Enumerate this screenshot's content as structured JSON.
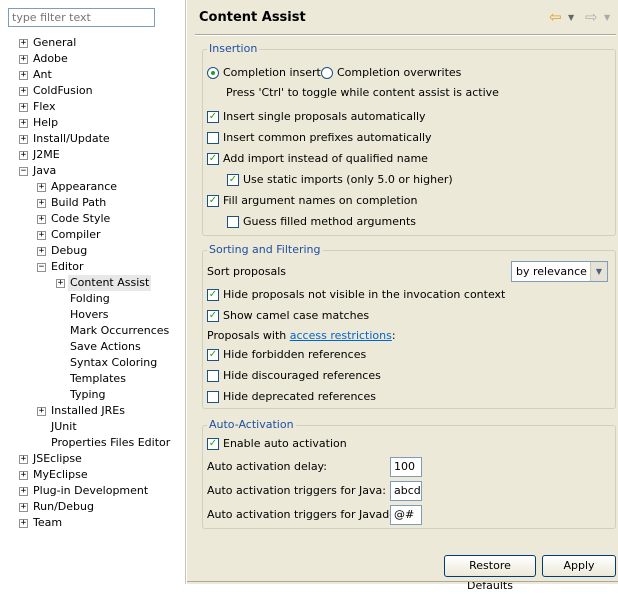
{
  "filter": {
    "placeholder": "type filter text"
  },
  "tree": [
    {
      "label": "General",
      "toggle": "+",
      "level": 0
    },
    {
      "label": "Adobe",
      "toggle": "+",
      "level": 0
    },
    {
      "label": "Ant",
      "toggle": "+",
      "level": 0
    },
    {
      "label": "ColdFusion",
      "toggle": "+",
      "level": 0
    },
    {
      "label": "Flex",
      "toggle": "+",
      "level": 0
    },
    {
      "label": "Help",
      "toggle": "+",
      "level": 0
    },
    {
      "label": "Install/Update",
      "toggle": "+",
      "level": 0
    },
    {
      "label": "J2ME",
      "toggle": "+",
      "level": 0
    },
    {
      "label": "Java",
      "toggle": "−",
      "level": 0
    },
    {
      "label": "Appearance",
      "toggle": "+",
      "level": 1
    },
    {
      "label": "Build Path",
      "toggle": "+",
      "level": 1
    },
    {
      "label": "Code Style",
      "toggle": "+",
      "level": 1
    },
    {
      "label": "Compiler",
      "toggle": "+",
      "level": 1
    },
    {
      "label": "Debug",
      "toggle": "+",
      "level": 1
    },
    {
      "label": "Editor",
      "toggle": "−",
      "level": 1
    },
    {
      "label": "Content Assist",
      "toggle": "+",
      "level": 2,
      "selected": true
    },
    {
      "label": "Folding",
      "toggle": "",
      "level": 2
    },
    {
      "label": "Hovers",
      "toggle": "",
      "level": 2
    },
    {
      "label": "Mark Occurrences",
      "toggle": "",
      "level": 2
    },
    {
      "label": "Save Actions",
      "toggle": "",
      "level": 2
    },
    {
      "label": "Syntax Coloring",
      "toggle": "",
      "level": 2
    },
    {
      "label": "Templates",
      "toggle": "",
      "level": 2
    },
    {
      "label": "Typing",
      "toggle": "",
      "level": 2
    },
    {
      "label": "Installed JREs",
      "toggle": "+",
      "level": 1
    },
    {
      "label": "JUnit",
      "toggle": "",
      "level": 1
    },
    {
      "label": "Properties Files Editor",
      "toggle": "",
      "level": 1
    },
    {
      "label": "JSEclipse",
      "toggle": "+",
      "level": 0
    },
    {
      "label": "MyEclipse",
      "toggle": "+",
      "level": 0
    },
    {
      "label": "Plug-in Development",
      "toggle": "+",
      "level": 0
    },
    {
      "label": "Run/Debug",
      "toggle": "+",
      "level": 0
    },
    {
      "label": "Team",
      "toggle": "+",
      "level": 0
    }
  ],
  "page": {
    "title": "Content Assist",
    "back_icon": "⇦",
    "forward_icon": "⇨",
    "dropdown_glyph": "▼"
  },
  "insertion": {
    "title": "Insertion",
    "radio_inserts": "Completion inserts",
    "radio_overwrites": "Completion overwrites",
    "hint": "Press 'Ctrl' to toggle while content assist is active",
    "single_proposals": "Insert single proposals automatically",
    "common_prefixes": "Insert common prefixes automatically",
    "add_import": "Add import instead of qualified name",
    "static_imports": "Use static imports (only 5.0 or higher)",
    "fill_args": "Fill argument names on completion",
    "guess_args": "Guess filled method arguments"
  },
  "sorting": {
    "title": "Sorting and Filtering",
    "sort_label": "Sort proposals",
    "sort_value": "by relevance",
    "hide_not_visible": "Hide proposals not visible in the invocation context",
    "camel_case": "Show camel case matches",
    "restrictions_prefix": "Proposals with ",
    "restrictions_link": "access restrictions",
    "restrictions_suffix": ":",
    "hide_forbidden": "Hide forbidden references",
    "hide_discouraged": "Hide discouraged references",
    "hide_deprecated": "Hide deprecated references"
  },
  "auto": {
    "title": "Auto-Activation",
    "enable": "Enable auto activation",
    "delay_label": "Auto activation delay:",
    "delay_value": "100",
    "java_label": "Auto activation triggers for Java:",
    "java_value": "abcde",
    "javadoc_label": "Auto activation triggers for Javadoc:",
    "javadoc_value": "@#"
  },
  "buttons": {
    "restore": "Restore Defaults",
    "apply": "Apply"
  },
  "checked_glyph": "✓",
  "colors": {
    "accent": "#1f4ea1",
    "link": "#0066cc",
    "check": "#21a121",
    "panel_bg": "#ece9d8"
  }
}
